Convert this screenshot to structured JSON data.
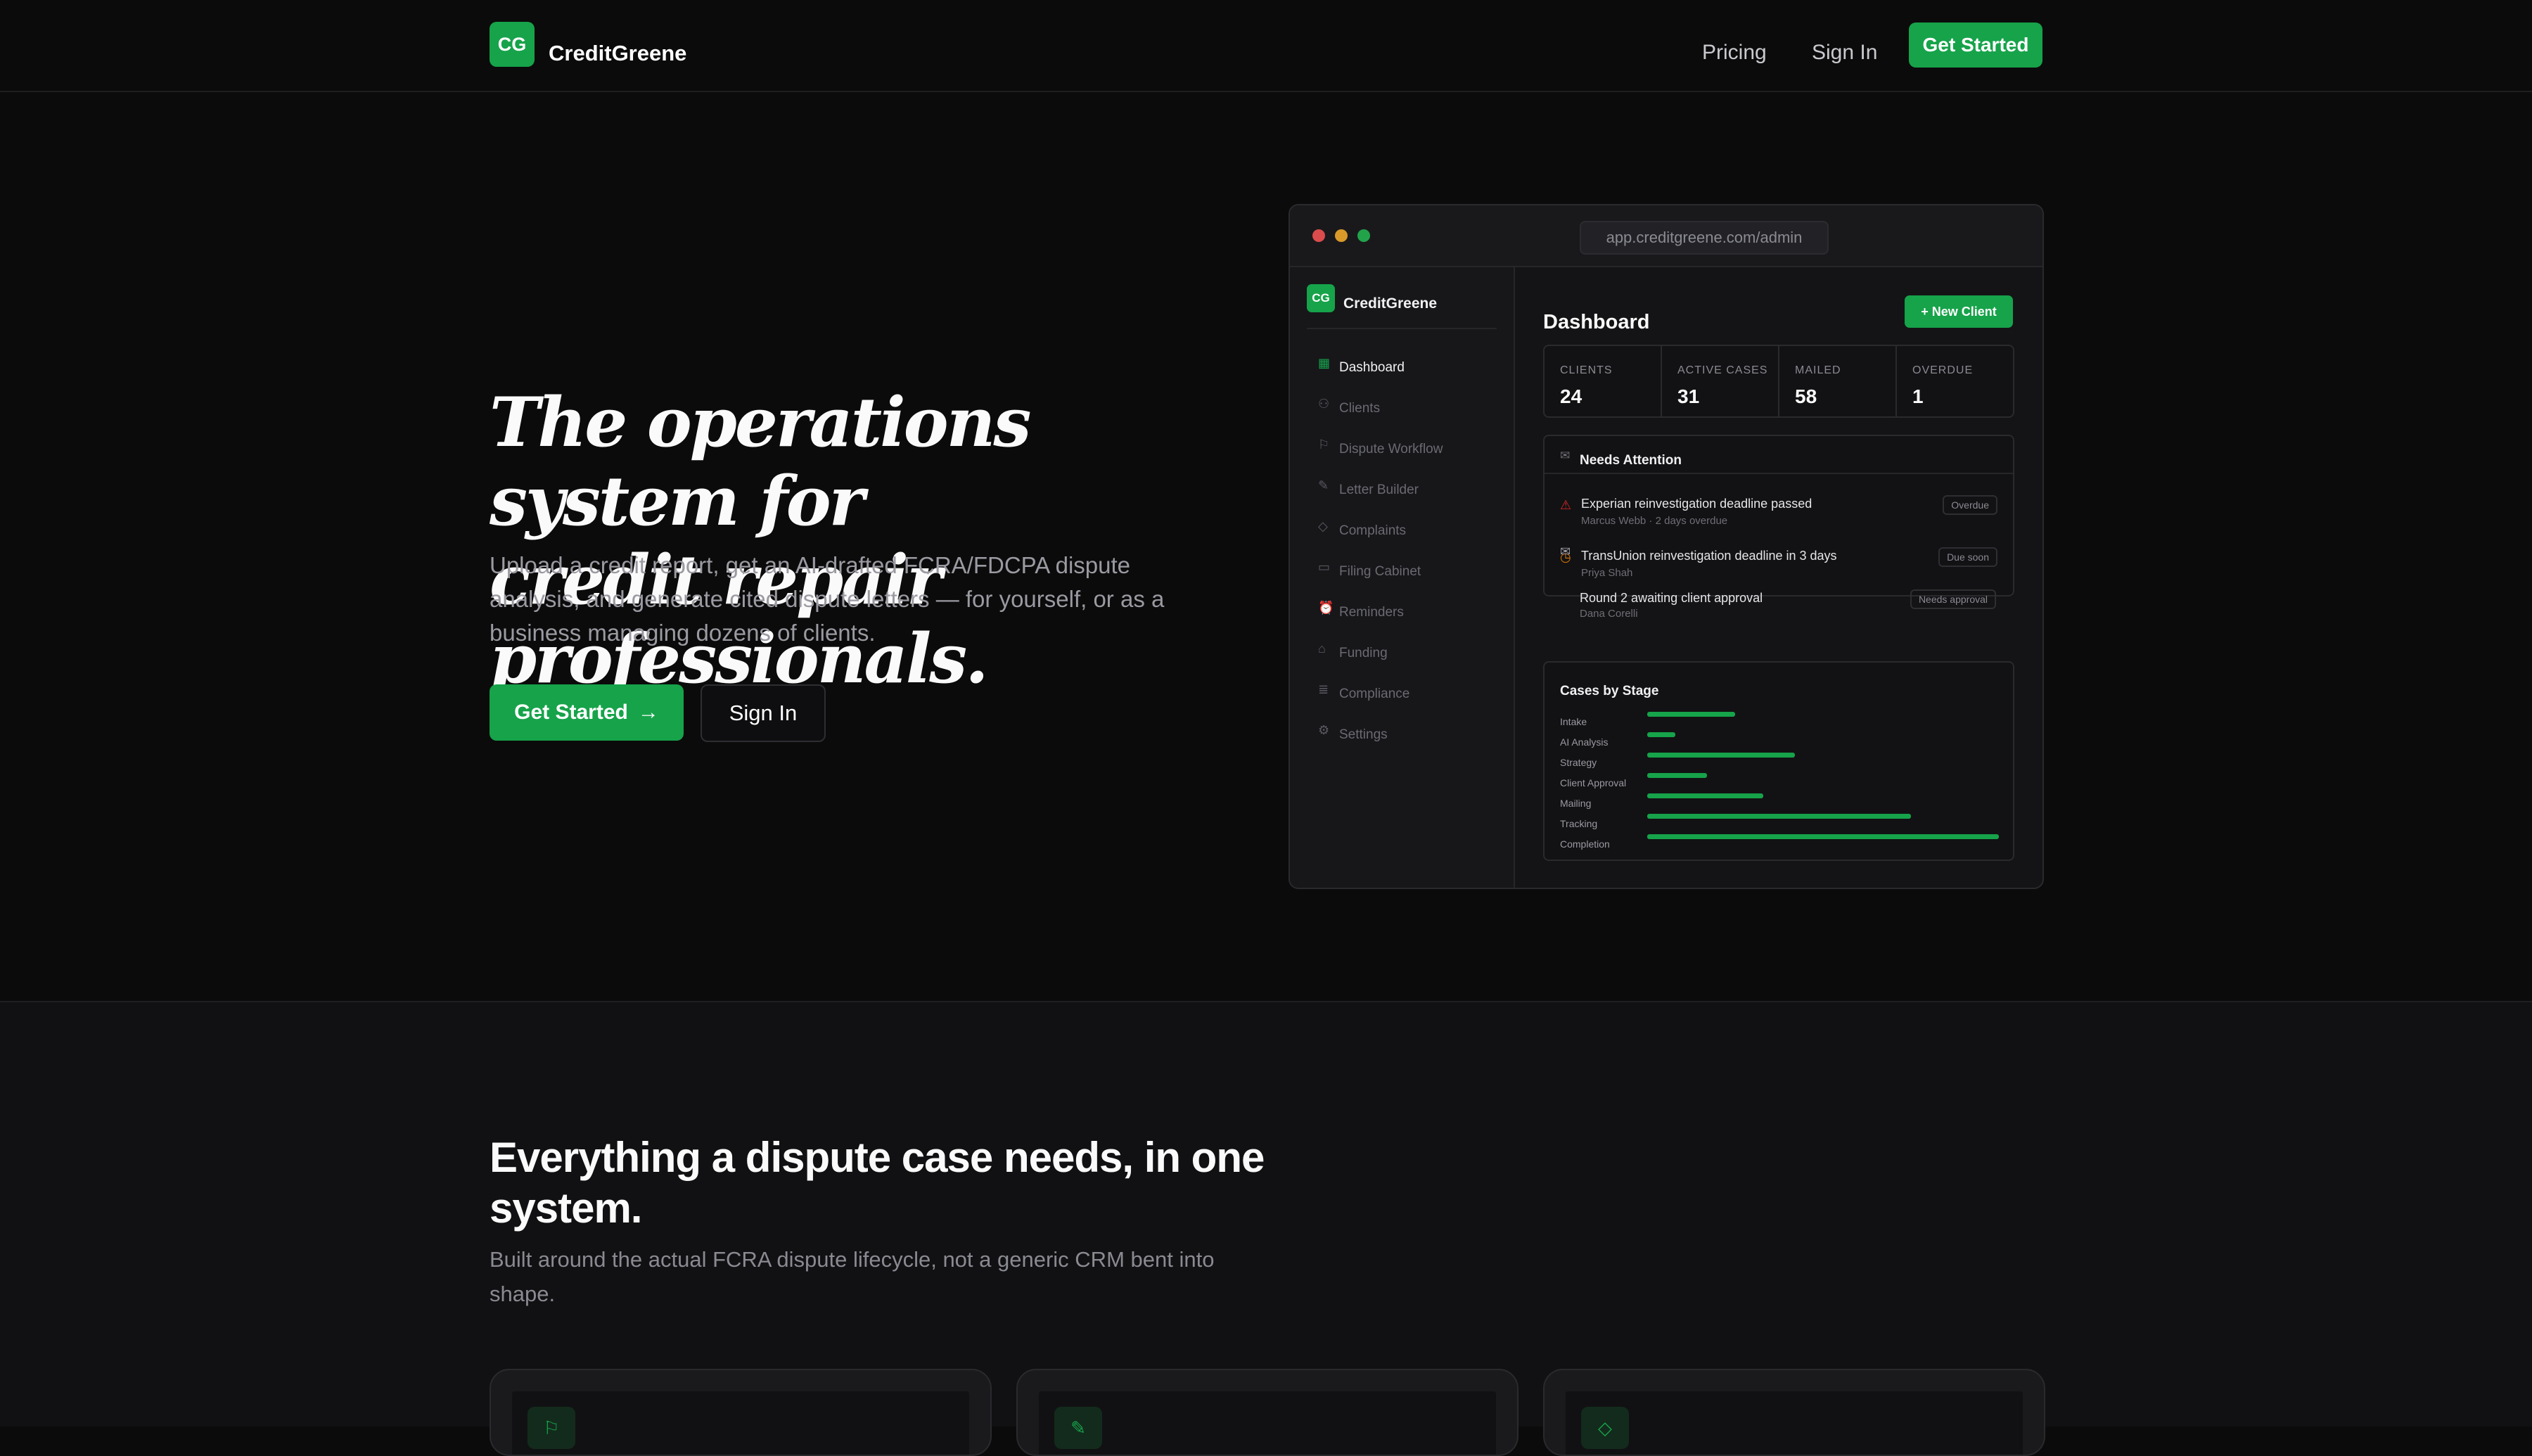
{
  "nav": {
    "logo_mark": "CG",
    "brand": "CreditGreene",
    "links": [
      "Pricing",
      "Sign In"
    ],
    "cta": "Get Started"
  },
  "hero": {
    "title_line1": "The operations system for",
    "title_line2": "credit repair professionals.",
    "subtitle": "Upload a credit report, get an AI-drafted FCRA/FDCPA dispute analysis, and generate cited dispute letters — for yourself, or as a business managing dozens of clients.",
    "primary_cta": "Get Started",
    "primary_cta_icon": "arrow-right-icon",
    "secondary_cta": "Sign In"
  },
  "app": {
    "url": "app.creditgreene.com/admin",
    "logo_mark": "CG",
    "brand": "CreditGreene",
    "sidebar": [
      {
        "label": "Dashboard",
        "icon": "grid-icon",
        "active": true
      },
      {
        "label": "Clients",
        "icon": "users-icon"
      },
      {
        "label": "Dispute Workflow",
        "icon": "flag-icon"
      },
      {
        "label": "Letter Builder",
        "icon": "edit-icon"
      },
      {
        "label": "Complaints",
        "icon": "shield-icon"
      },
      {
        "label": "Filing Cabinet",
        "icon": "folder-icon"
      },
      {
        "label": "Reminders",
        "icon": "alarm-icon"
      },
      {
        "label": "Funding",
        "icon": "bank-icon"
      },
      {
        "label": "Compliance",
        "icon": "scroll-icon"
      },
      {
        "label": "Settings",
        "icon": "gear-icon"
      }
    ],
    "dashboard_title": "Dashboard",
    "new_client": "+ New Client",
    "stats": [
      {
        "label": "CLIENTS",
        "value": "24"
      },
      {
        "label": "ACTIVE CASES",
        "value": "31"
      },
      {
        "label": "MAILED",
        "value": "58"
      },
      {
        "label": "OVERDUE",
        "value": "1"
      }
    ],
    "attention": {
      "title": "Needs Attention",
      "items": [
        {
          "title": "Experian reinvestigation deadline passed",
          "meta": "Marcus Webb · 2 days overdue",
          "badge": "Overdue",
          "icon": "warning-icon",
          "color": "#dc2626"
        },
        {
          "title": "TransUnion reinvestigation deadline in 3 days",
          "meta": "Priya Shah",
          "badge": "Due soon",
          "icon": "clock-icon",
          "color": "#d97706"
        },
        {
          "title": "Round 2 awaiting client approval",
          "meta": "Dana Corelli",
          "badge": "Needs approval",
          "icon": "mail-icon",
          "color": "#9a9aa2"
        }
      ]
    },
    "stages": {
      "title": "Cases by Stage",
      "rows": [
        {
          "label": "Intake",
          "value": 0.25
        },
        {
          "label": "AI Analysis",
          "value": 0.08
        },
        {
          "label": "Strategy",
          "value": 0.42
        },
        {
          "label": "Client Approval",
          "value": 0.17
        },
        {
          "label": "Mailing",
          "value": 0.33
        },
        {
          "label": "Tracking",
          "value": 0.75
        },
        {
          "label": "Completion",
          "value": 1.0
        }
      ]
    }
  },
  "features": {
    "title": "Everything a dispute case needs, in one system.",
    "subtitle": "Built around the actual FCRA dispute lifecycle, not a generic CRM bent into shape.",
    "card_icons": [
      "flag-icon",
      "edit-icon",
      "shield-icon"
    ]
  },
  "colors": {
    "accent": "#16a34a",
    "background": "#0b0b0b",
    "panel": "#141416"
  }
}
